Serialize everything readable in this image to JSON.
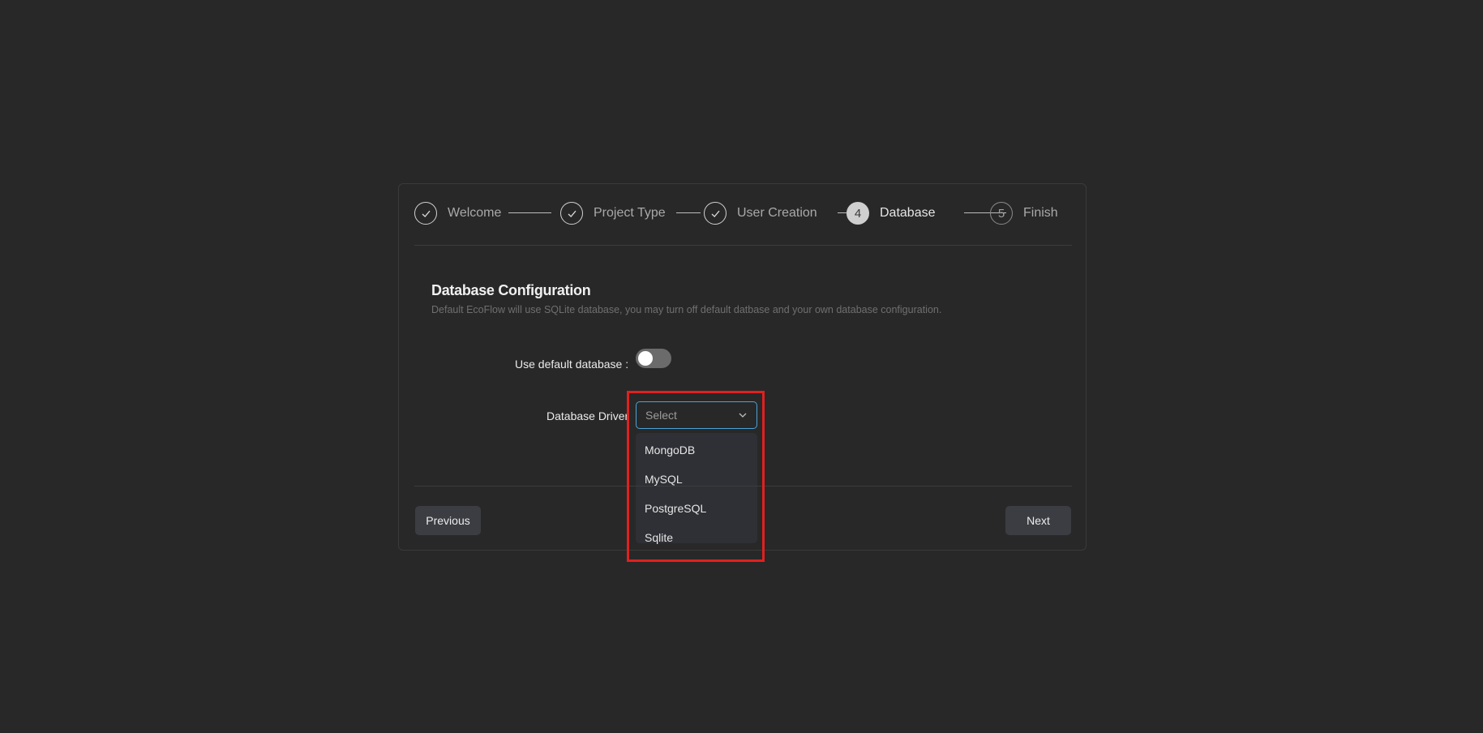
{
  "steps": [
    {
      "label": "Welcome",
      "state": "done",
      "icon": "check-icon"
    },
    {
      "label": "Project Type",
      "state": "done",
      "icon": "check-icon"
    },
    {
      "label": "User Creation",
      "state": "done",
      "icon": "check-icon"
    },
    {
      "label": "Database",
      "state": "active",
      "number": "4"
    },
    {
      "label": "Finish",
      "state": "pending",
      "number": "5"
    }
  ],
  "section": {
    "title": "Database Configuration",
    "subtitle": "Default EcoFlow will use SQLite database, you may turn off default datbase and your own database configuration."
  },
  "form": {
    "default_db_label": "Use default database :",
    "default_db_enabled": false,
    "driver_label": "Database Driver",
    "driver_placeholder": "Select",
    "driver_options": [
      "MongoDB",
      "MySQL",
      "PostgreSQL",
      "Sqlite"
    ]
  },
  "buttons": {
    "previous": "Previous",
    "next": "Next"
  },
  "colors": {
    "background": "#282828",
    "focus_border": "#4aa3d8",
    "highlight": "#e02020",
    "button_bg": "#3b3d42"
  }
}
